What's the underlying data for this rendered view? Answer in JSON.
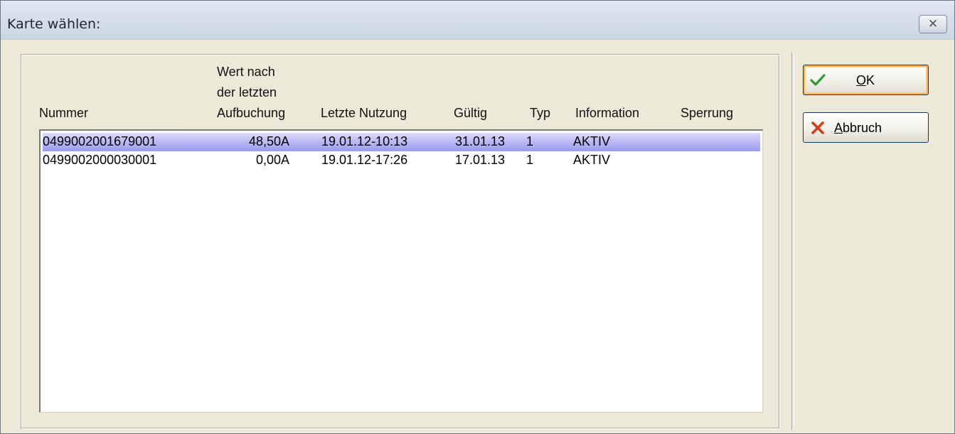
{
  "window": {
    "title": "Karte wählen:",
    "close_glyph": "✕"
  },
  "columns": {
    "nummer": "Nummer",
    "wert_line1": "Wert nach",
    "wert_line2": "der letzten",
    "wert_line3": "Aufbuchung",
    "letzte_nutzung": "Letzte Nutzung",
    "gueltig": "Gültig",
    "typ": "Typ",
    "information": "Information",
    "sperrung": "Sperrung"
  },
  "rows": [
    {
      "nummer": "0499002001679001",
      "wert": "48,50A",
      "letzte_nutzung": "19.01.12-10:13",
      "gueltig": "31.01.13",
      "typ": "1",
      "information": "AKTIV",
      "sperrung": "",
      "selected": true
    },
    {
      "nummer": "0499002000030001",
      "wert": "0,00A",
      "letzte_nutzung": "19.01.12-17:26",
      "gueltig": "17.01.13",
      "typ": "1",
      "information": "AKTIV",
      "sperrung": "",
      "selected": false
    }
  ],
  "buttons": {
    "ok_label_mnemonic": "O",
    "ok_label_rest": "K",
    "ok_icon": "check-icon",
    "abbruch_label_mnemonic": "A",
    "abbruch_label_rest": "bbruch",
    "abbruch_icon": "cross-icon"
  },
  "colors": {
    "selection": "#b5b5f4",
    "ok_check": "#2e9a2e",
    "abbruch_cross": "#d43c1a"
  }
}
